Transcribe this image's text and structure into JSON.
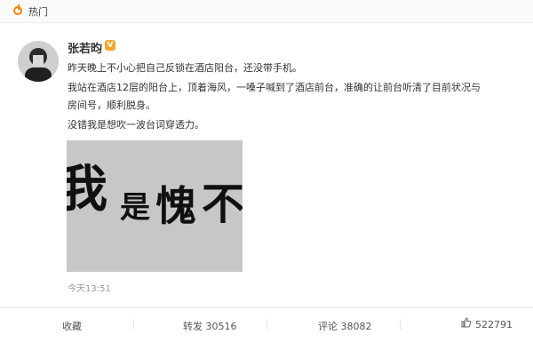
{
  "header": {
    "hot_label": "热门"
  },
  "post": {
    "author": "张若昀",
    "lines": [
      "昨天晚上不小心把自己反锁在酒店阳台，还没带手机。",
      "我站在酒店12层的阳台上，顶着海风，一嗓子喊到了酒店前台，准确的让前台听清了目前状况与",
      "房间号，顺利脱身。",
      "没错我是想吹一波台词穿透力。"
    ],
    "image_text": [
      "我",
      "是",
      "愧",
      "不"
    ],
    "time": "今天13:51"
  },
  "actions": {
    "favorite": "收藏",
    "repost": "转发 30516",
    "comment": "评论 38082",
    "like": "522791"
  },
  "colors": {
    "accent": "#ff8200",
    "vip": "#f5a623"
  }
}
